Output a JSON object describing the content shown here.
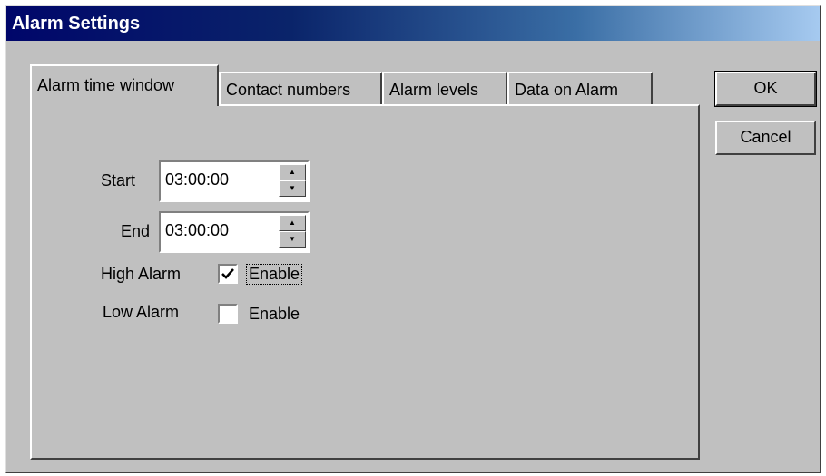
{
  "window": {
    "title": "Alarm Settings"
  },
  "tabs": [
    "Alarm time window",
    "Contact numbers",
    "Alarm levels",
    "Data on Alarm"
  ],
  "buttons": {
    "ok": "OK",
    "cancel": "Cancel"
  },
  "start": {
    "label": "Start",
    "value": "03:00:00"
  },
  "end": {
    "label": "End",
    "value": "03:00:00"
  },
  "high_alarm": {
    "label": "High Alarm",
    "checkbox_label": "Enable",
    "checked": true
  },
  "low_alarm": {
    "label": "Low Alarm",
    "checkbox_label": "Enable",
    "checked": false
  },
  "icons": {
    "spin_up": "spin-up-arrow",
    "spin_down": "spin-down-arrow",
    "check": "check-mark"
  },
  "colors": {
    "face": "#c0c0c0",
    "title_start": "#00066a",
    "title_end": "#a6caf0"
  }
}
